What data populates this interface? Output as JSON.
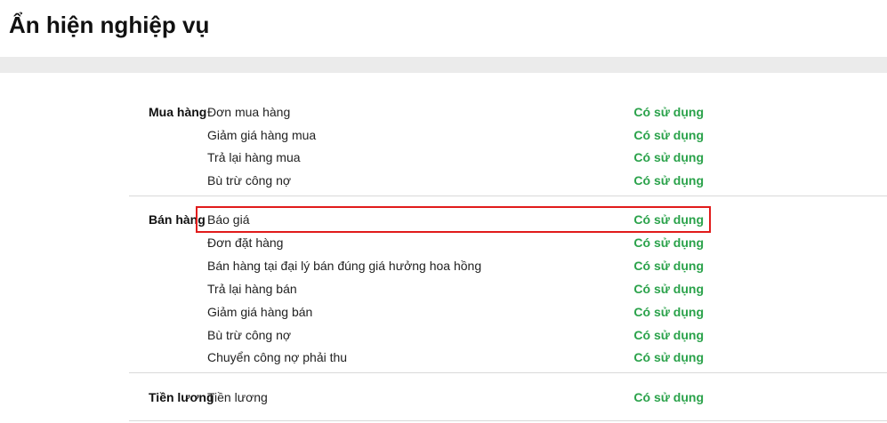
{
  "page": {
    "title": "Ẩn hiện nghiệp vụ"
  },
  "status_color": "#2aa24a",
  "highlight_color": "#e11b1b",
  "groups": [
    {
      "title": "Mua hàng",
      "items": [
        {
          "label": "Đơn mua hàng",
          "status": "Có sử dụng"
        },
        {
          "label": "Giảm giá hàng mua",
          "status": "Có sử dụng"
        },
        {
          "label": "Trả lại hàng mua",
          "status": "Có sử dụng"
        },
        {
          "label": "Bù trừ công nợ",
          "status": "Có sử dụng"
        }
      ]
    },
    {
      "title": "Bán hàng",
      "items": [
        {
          "label": "Báo giá",
          "status": "Có sử dụng"
        },
        {
          "label": "Đơn đặt hàng",
          "status": "Có sử dụng"
        },
        {
          "label": "Bán hàng tại đại lý bán đúng giá hưởng hoa hồng",
          "status": "Có sử dụng"
        },
        {
          "label": "Trả lại hàng bán",
          "status": "Có sử dụng"
        },
        {
          "label": "Giảm giá hàng bán",
          "status": "Có sử dụng"
        },
        {
          "label": "Bù trừ công nợ",
          "status": "Có sử dụng"
        },
        {
          "label": "Chuyển công nợ phải thu",
          "status": "Có sử dụng"
        }
      ]
    },
    {
      "title": "Tiền lương",
      "items": [
        {
          "label": "Tiền lương",
          "status": "Có sử dụng"
        }
      ]
    }
  ]
}
